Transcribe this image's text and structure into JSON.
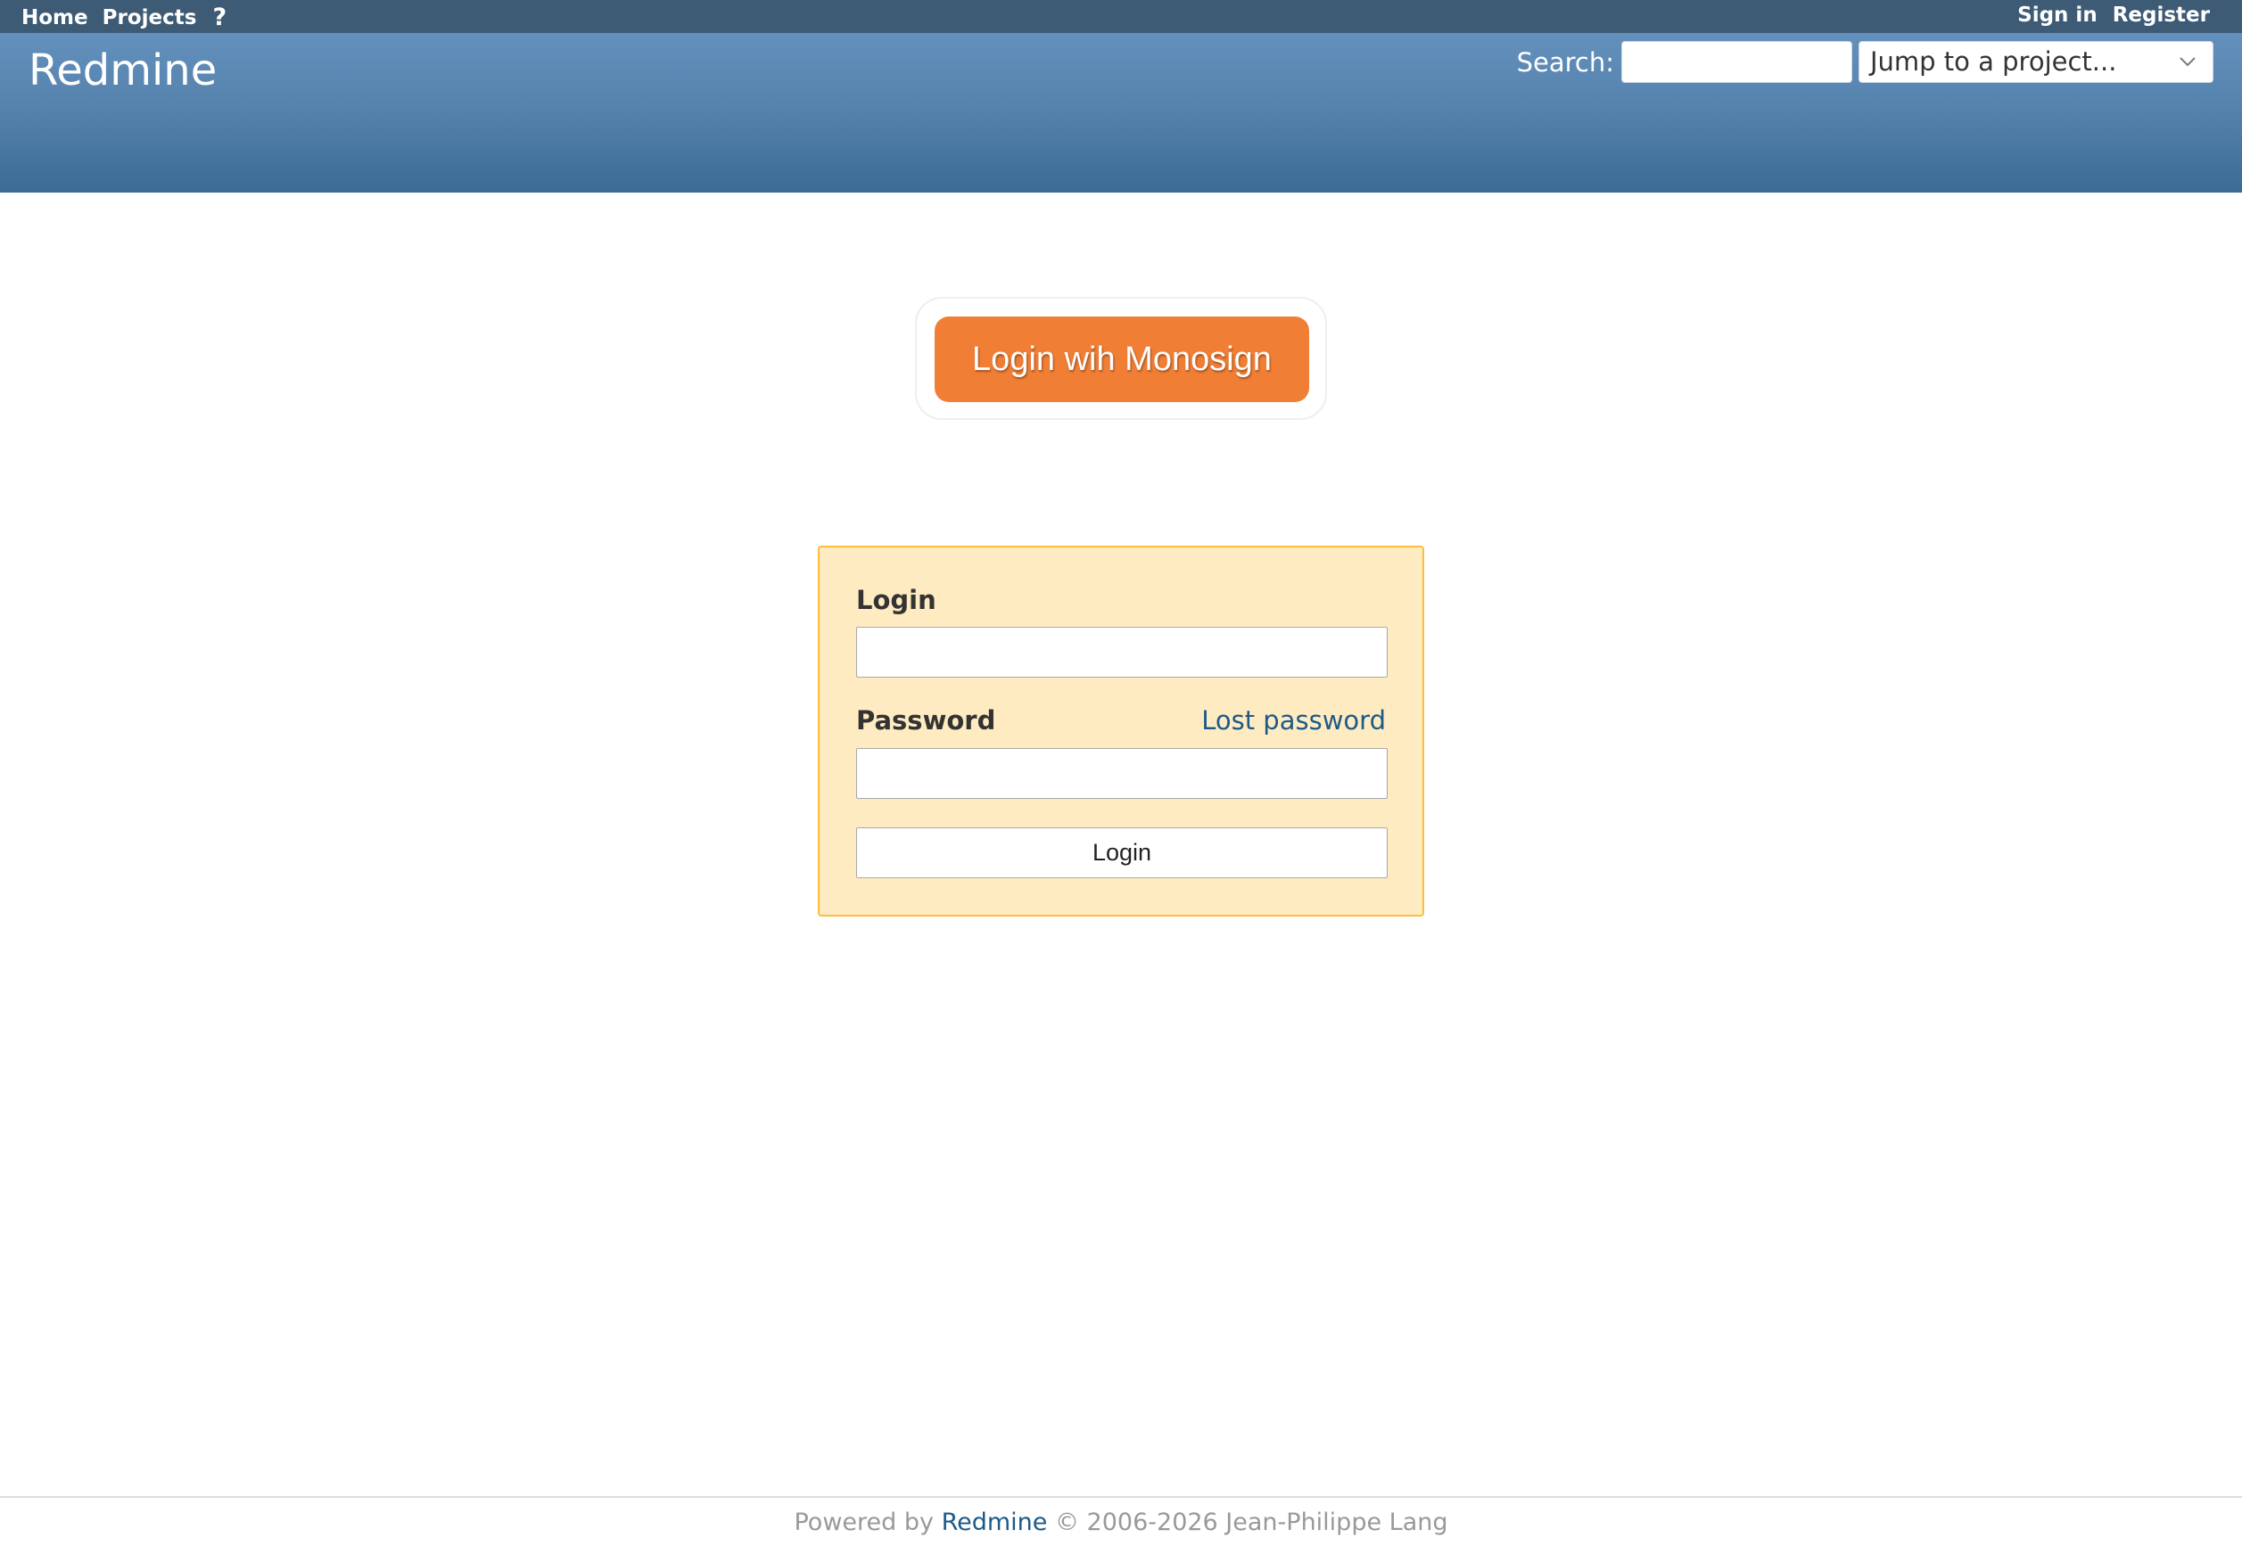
{
  "top_menu": {
    "home": "Home",
    "projects": "Projects",
    "help": "?",
    "sign_in": "Sign in",
    "register": "Register"
  },
  "header": {
    "title": "Redmine",
    "search_label": "Search:",
    "search_value": "",
    "project_jump": "Jump to a project..."
  },
  "main": {
    "monosign_button": "Login wih Monosign",
    "login_label": "Login",
    "password_label": "Password",
    "lost_password": "Lost password",
    "submit_label": "Login"
  },
  "footer": {
    "prefix": "Powered by ",
    "link": "Redmine",
    "suffix": " © 2006-2026 Jean-Philippe Lang"
  },
  "colors": {
    "top_menu_bg": "#3e5b76",
    "header_top": "#6390bc",
    "header_bottom": "#3a6c94",
    "monosign_orange": "#f17e35",
    "login_box_bg": "#ffebc1",
    "login_box_border": "#fdbd3b",
    "link": "#1d5a88"
  },
  "icons": {
    "help": "question-mark-icon",
    "dropdown": "chevron-down-icon"
  }
}
